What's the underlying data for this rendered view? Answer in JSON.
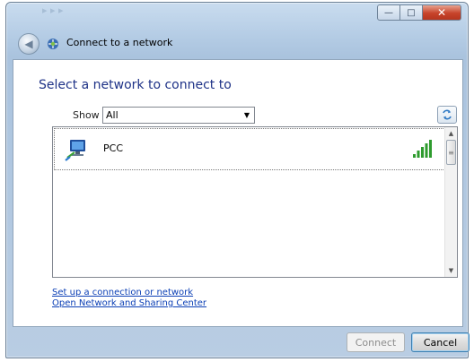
{
  "window": {
    "title": "Connect to a network",
    "controls": {
      "minimize": "—",
      "maximize": "□",
      "close": "✕"
    }
  },
  "dialog": {
    "heading": "Select a network to connect to",
    "show_label": "Show",
    "show_selected": "All"
  },
  "networks": [
    {
      "name": "PCC",
      "signal_bars": 5,
      "signal_max": 5
    }
  ],
  "links": {
    "setup": "Set up a connection or network",
    "open_center": "Open Network and Sharing Center"
  },
  "buttons": {
    "connect": "Connect",
    "cancel": "Cancel"
  },
  "colors": {
    "heading": "#1e3287",
    "link": "#0b3fb5",
    "signal": "#2e9b2e"
  }
}
